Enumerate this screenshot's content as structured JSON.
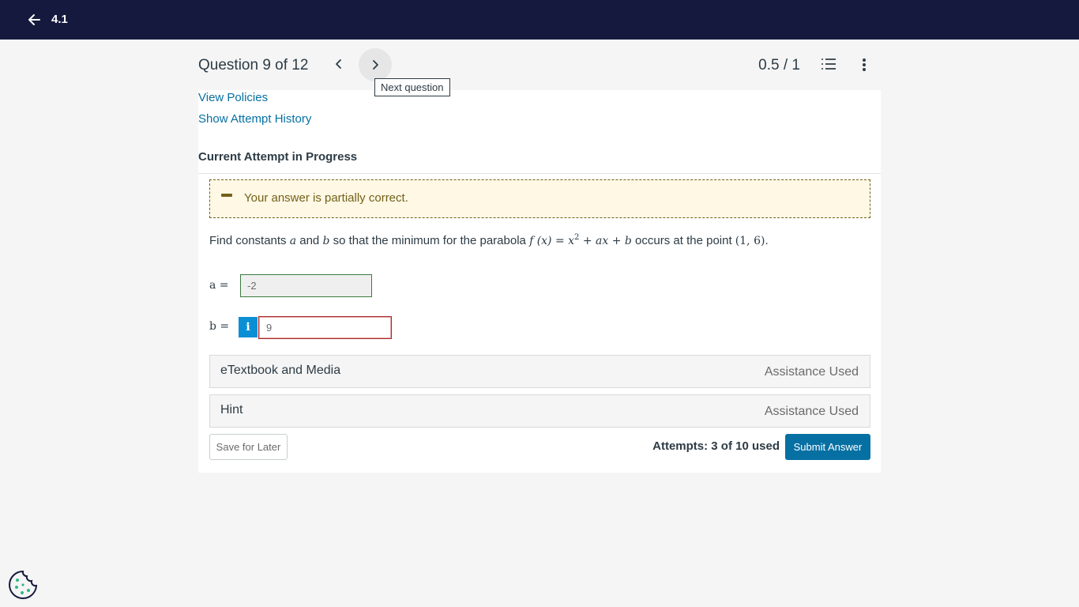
{
  "topbar": {
    "back_icon": "arrow-left-icon",
    "title": "4.1"
  },
  "header": {
    "question_label": "Question 9 of 12",
    "prev_icon": "chevron-left-icon",
    "next_icon": "chevron-right-icon",
    "tooltip": "Next question",
    "score": "0.5 / 1",
    "list_icon": "numbered-list-icon",
    "more_icon": "more-vertical-icon"
  },
  "links": {
    "view_policies": "View Policies",
    "attempt_history": "Show Attempt History"
  },
  "attempt_heading": "Current Attempt in Progress",
  "alert": {
    "text": "Your answer is partially correct.",
    "color": "#73601c",
    "background": "#fef8e4"
  },
  "problem": {
    "p1": "Find constants ",
    "var_a": "a",
    "p2": " and ",
    "var_b": "b",
    "p3": " so that the minimum for the parabola ",
    "func": "f (x) = x",
    "sup": "2",
    "func_rest": " + ax + b",
    "p4": " occurs at the point ",
    "point": "(1, 6)",
    "p5": "."
  },
  "answers": {
    "a_label": "a =",
    "a_value": "-2",
    "a_status": "correct",
    "b_label": "b =",
    "b_value": "9",
    "b_status": "incorrect",
    "info_label": "i"
  },
  "accordions": [
    {
      "title": "eTextbook and Media",
      "status": "Assistance Used"
    },
    {
      "title": "Hint",
      "status": "Assistance Used"
    }
  ],
  "footer": {
    "save_label": "Save for Later",
    "attempts": "Attempts: 3 of 10 used",
    "submit_label": "Submit Answer"
  },
  "colors": {
    "topbar": "#14193d",
    "link": "#0770a3",
    "primary_button": "#0770a3",
    "info_button": "#0b8fd4",
    "correct_border": "#3d7a3d",
    "incorrect_border": "#a52a2a"
  },
  "cookie_icon": "cookie-icon"
}
